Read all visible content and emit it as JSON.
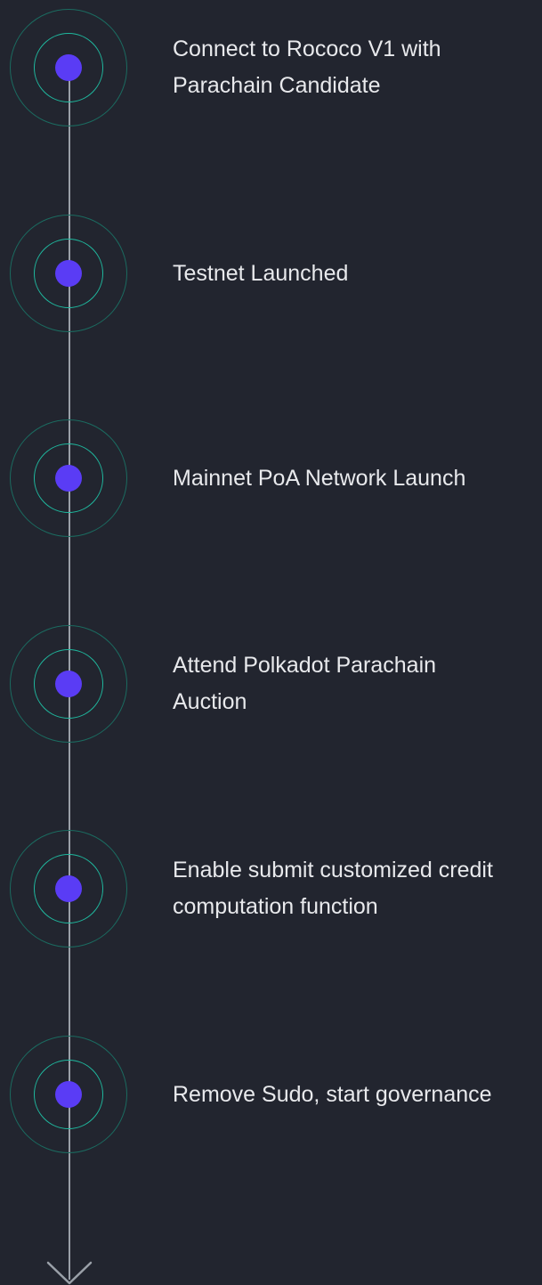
{
  "milestones": [
    {
      "label": "Connect to Rococo V1 with\nParachain Candidate"
    },
    {
      "label": "Testnet Launched"
    },
    {
      "label": "Mainnet PoA Network Launch"
    },
    {
      "label": "Attend Polkadot Parachain\nAuction"
    },
    {
      "label": "Enable submit customized credit\ncomputation function"
    },
    {
      "label": "Remove Sudo, start governance"
    }
  ],
  "colors": {
    "background": "#22252f",
    "dot": "#5a3cf5",
    "inner_ring": "#1fb89e",
    "outer_ring": "#1b6b60",
    "line": "#9aa0a8",
    "text": "#e8e9ec"
  }
}
